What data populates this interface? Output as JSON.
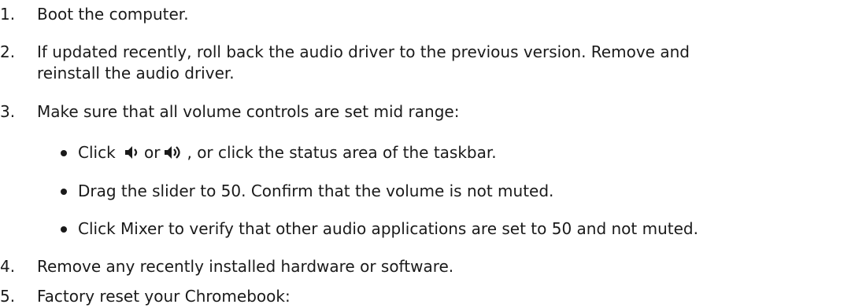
{
  "steps": [
    {
      "number": "1.",
      "text": "Boot the computer."
    },
    {
      "number": "2.",
      "text": "If updated recently, roll back the audio driver to the previous version. Remove and",
      "text2": "reinstall the audio driver."
    },
    {
      "number": "3.",
      "text": "Make sure that all volume controls are set mid range:"
    },
    {
      "number": "4.",
      "text": "Remove any recently installed hardware or software."
    },
    {
      "number": "5.",
      "text": "Factory reset your Chromebook:"
    }
  ],
  "bullets": {
    "click_prefix": "Click",
    "click_or": "or",
    "click_suffix": ", or click the status area of the taskbar.",
    "drag": "Drag the slider to 50. Confirm that the volume is not muted.",
    "mixer": "Click Mixer to verify that other audio applications are set to 50 and not muted."
  },
  "icons": {
    "low": "speaker-low-icon",
    "high": "speaker-high-icon"
  }
}
